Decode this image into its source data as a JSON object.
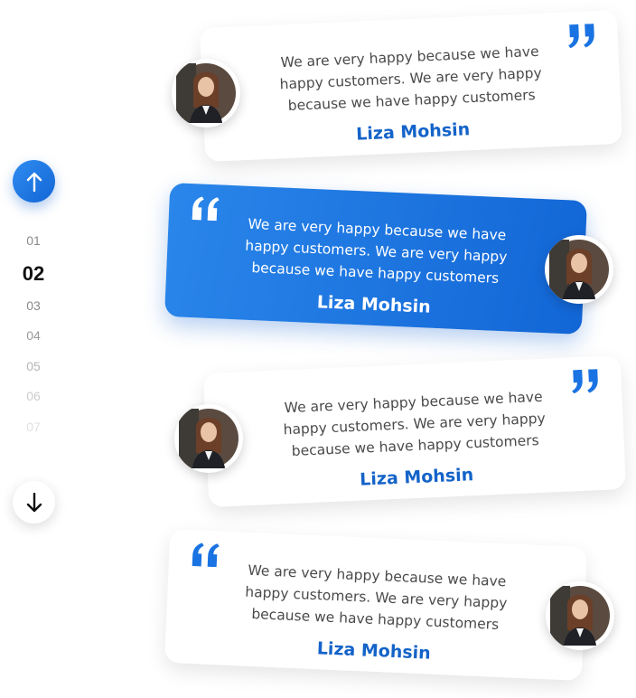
{
  "navigation": {
    "up_icon": "arrow-up-icon",
    "down_icon": "arrow-down-icon",
    "accent_color": "#1a73e2",
    "pages": [
      {
        "label": "01",
        "color": "#8a8a8a"
      },
      {
        "label": "02",
        "color": "#111111"
      },
      {
        "label": "03",
        "color": "#8a8a8a"
      },
      {
        "label": "04",
        "color": "#9a9a9a"
      },
      {
        "label": "05",
        "color": "#b5b5b5"
      },
      {
        "label": "06",
        "color": "#cccccc"
      },
      {
        "label": "07",
        "color": "#e0e0e0"
      }
    ],
    "active_index": 1
  },
  "testimonials": [
    {
      "text": "We are very happy because we have happy customers. We are very happy because we have happy customers",
      "name": "Liza Mohsin",
      "highlighted": false,
      "quote_icon": "quote-close-icon"
    },
    {
      "text": "We are very happy because we have happy customers. We are very happy because we have happy customers",
      "name": "Liza Mohsin",
      "highlighted": true,
      "quote_icon": "quote-open-icon"
    },
    {
      "text": "We are very happy because we have happy customers. We are very happy because we have happy customers",
      "name": "Liza Mohsin",
      "highlighted": false,
      "quote_icon": "quote-close-icon"
    },
    {
      "text": "We are very happy because we have happy customers. We are very happy because we have happy customers",
      "name": "Liza Mohsin",
      "highlighted": false,
      "quote_icon": "quote-open-icon"
    }
  ]
}
